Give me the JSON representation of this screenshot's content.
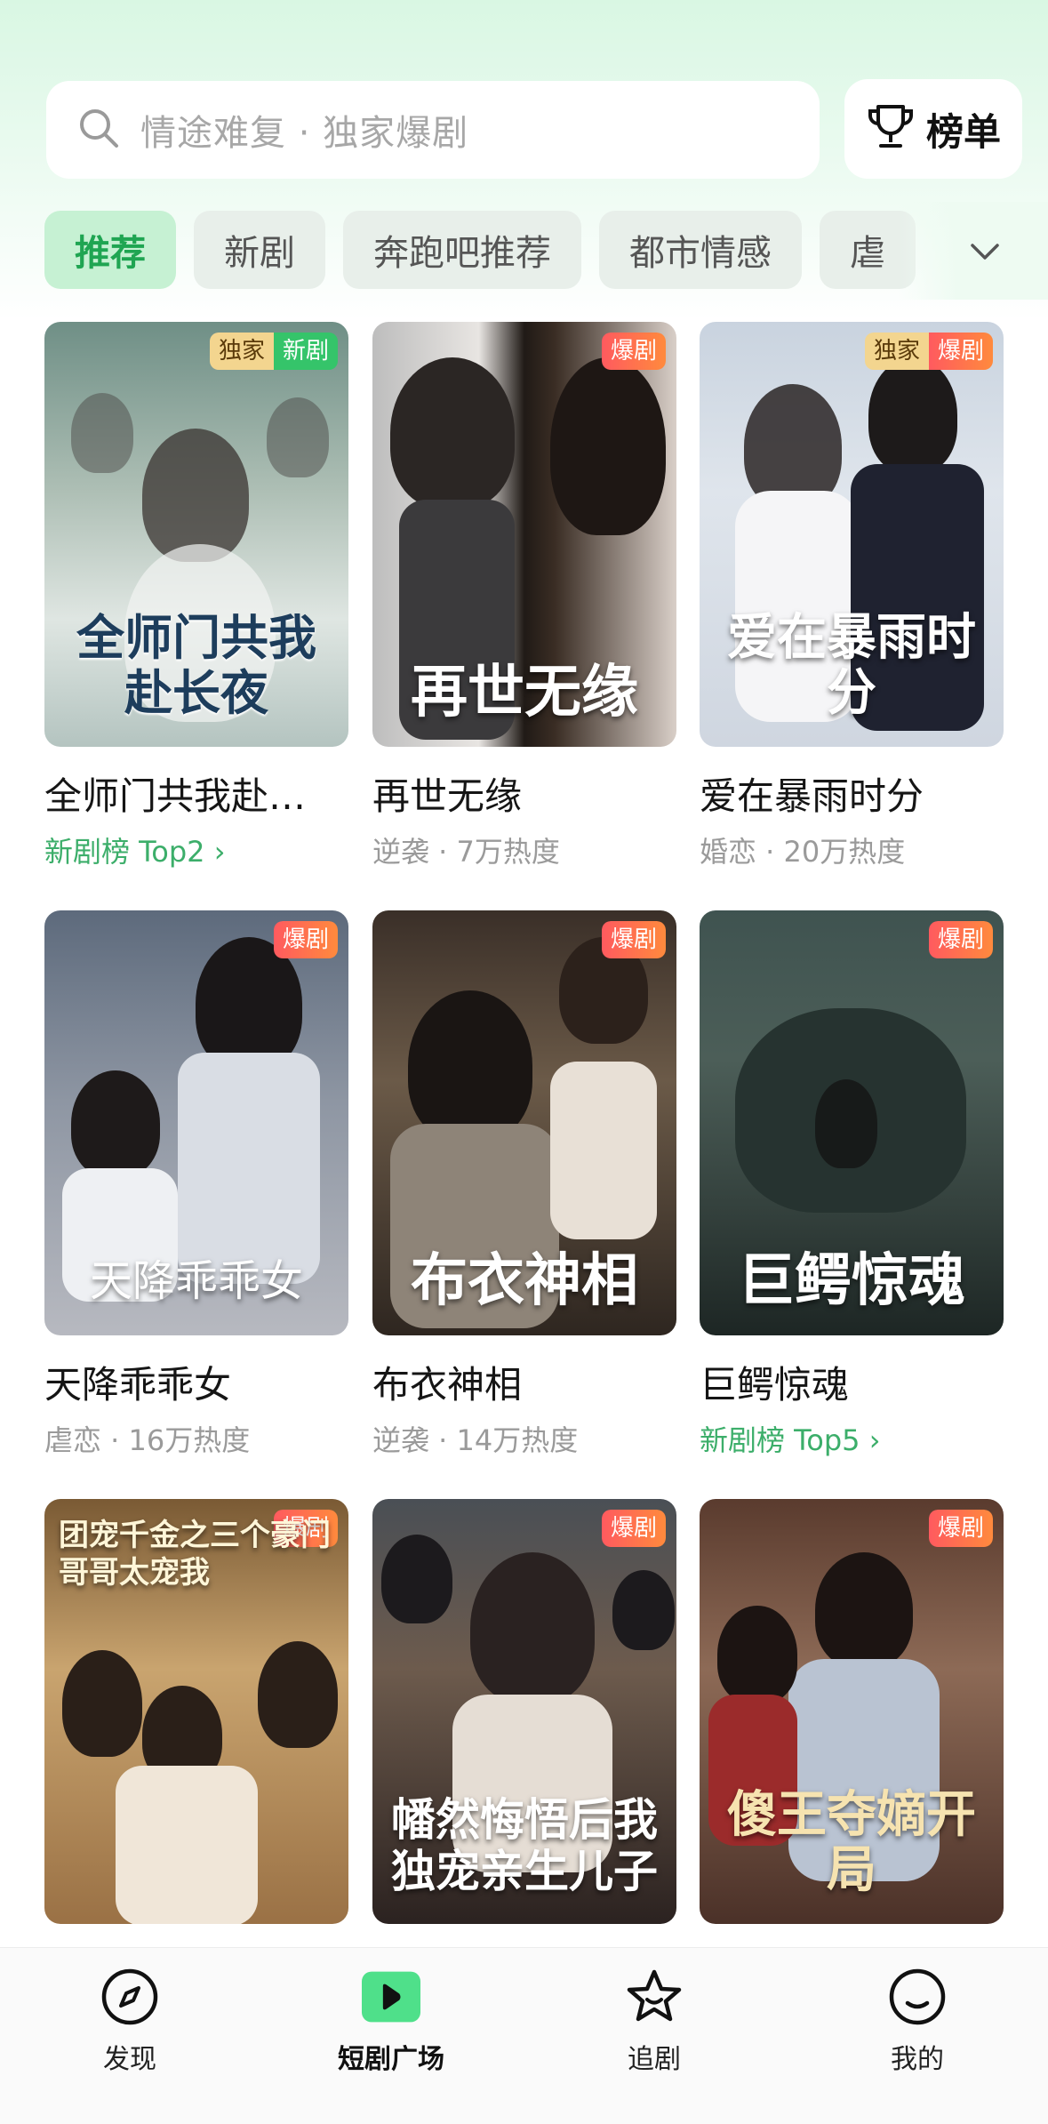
{
  "search": {
    "placeholder": "情途难复 · 独家爆剧"
  },
  "rank_button": {
    "label": "榜单"
  },
  "tabs": [
    {
      "label": "推荐",
      "active": true
    },
    {
      "label": "新剧",
      "active": false
    },
    {
      "label": "奔跑吧推荐",
      "active": false
    },
    {
      "label": "都市情感",
      "active": false
    },
    {
      "label": "虐",
      "active": false
    }
  ],
  "dramas": [
    {
      "poster_text": "全师门共我赴长夜",
      "title": "全师门共我赴…",
      "subtitle": "新剧榜 Top2 ›",
      "subtitle_type": "rank",
      "badges": [
        "独家",
        "新剧"
      ]
    },
    {
      "poster_text": "再世无缘",
      "title": "再世无缘",
      "subtitle": "逆袭 · 7万热度",
      "subtitle_type": "meta",
      "badges": [
        "爆剧"
      ]
    },
    {
      "poster_text": "爱在暴雨时分",
      "title": "爱在暴雨时分",
      "subtitle": "婚恋 · 20万热度",
      "subtitle_type": "meta",
      "badges": [
        "独家",
        "爆剧"
      ]
    },
    {
      "poster_text": "天降乖乖女",
      "title": "天降乖乖女",
      "subtitle": "虐恋 · 16万热度",
      "subtitle_type": "meta",
      "badges": [
        "爆剧"
      ]
    },
    {
      "poster_text": "布衣神相",
      "title": "布衣神相",
      "subtitle": "逆袭 · 14万热度",
      "subtitle_type": "meta",
      "badges": [
        "爆剧"
      ]
    },
    {
      "poster_text": "巨鳄惊魂",
      "title": "巨鳄惊魂",
      "subtitle": "新剧榜 Top5 ›",
      "subtitle_type": "rank",
      "badges": [
        "爆剧"
      ]
    },
    {
      "poster_text": "团宠千金之三个豪门哥哥太宠我",
      "badges": [
        "爆剧"
      ]
    },
    {
      "poster_text": "幡然悔悟后我独宠亲生儿子",
      "badges": [
        "爆剧"
      ]
    },
    {
      "poster_text": "傻王夺嫡开局",
      "badges": [
        "爆剧"
      ]
    }
  ],
  "nav": [
    {
      "label": "发现",
      "icon": "compass-icon",
      "active": false
    },
    {
      "label": "短剧广场",
      "icon": "play-icon",
      "active": true
    },
    {
      "label": "追剧",
      "icon": "star-icon",
      "active": false
    },
    {
      "label": "我的",
      "icon": "smile-icon",
      "active": false
    }
  ],
  "colors": {
    "accent": "#1fa552",
    "hot_badge": "#ff5a5f",
    "new_badge": "#35c46a"
  }
}
